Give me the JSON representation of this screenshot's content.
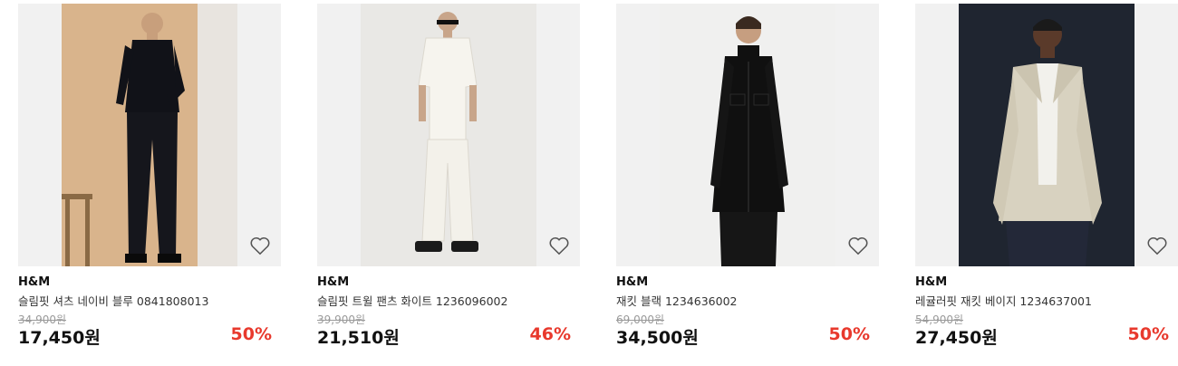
{
  "products": [
    {
      "brand": "H&M",
      "name": "슬림핏 셔츠 네이비 블루 0841808013",
      "original_price": "34,900원",
      "price": "17,450원",
      "discount": "50%",
      "photo_bg": "#d9b48c",
      "icon": "heart-outline-icon"
    },
    {
      "brand": "H&M",
      "name": "슬림핏 트윌 팬츠 화이트 1236096002",
      "original_price": "39,900원",
      "price": "21,510원",
      "discount": "46%",
      "photo_bg": "#e9e8e5",
      "icon": "heart-outline-icon"
    },
    {
      "brand": "H&M",
      "name": "재킷 블랙 1234636002",
      "original_price": "69,000원",
      "price": "34,500원",
      "discount": "50%",
      "photo_bg": "#f0f0ef",
      "icon": "heart-outline-icon"
    },
    {
      "brand": "H&M",
      "name": "레귤러핏 재킷 베이지 1234637001",
      "original_price": "54,900원",
      "price": "27,450원",
      "discount": "50%",
      "photo_bg": "#1f2530",
      "icon": "heart-outline-icon"
    }
  ],
  "colors": {
    "discount": "#e8392d",
    "original_price": "#9a9a9a",
    "thumb_bg": "#f1f1f1"
  }
}
